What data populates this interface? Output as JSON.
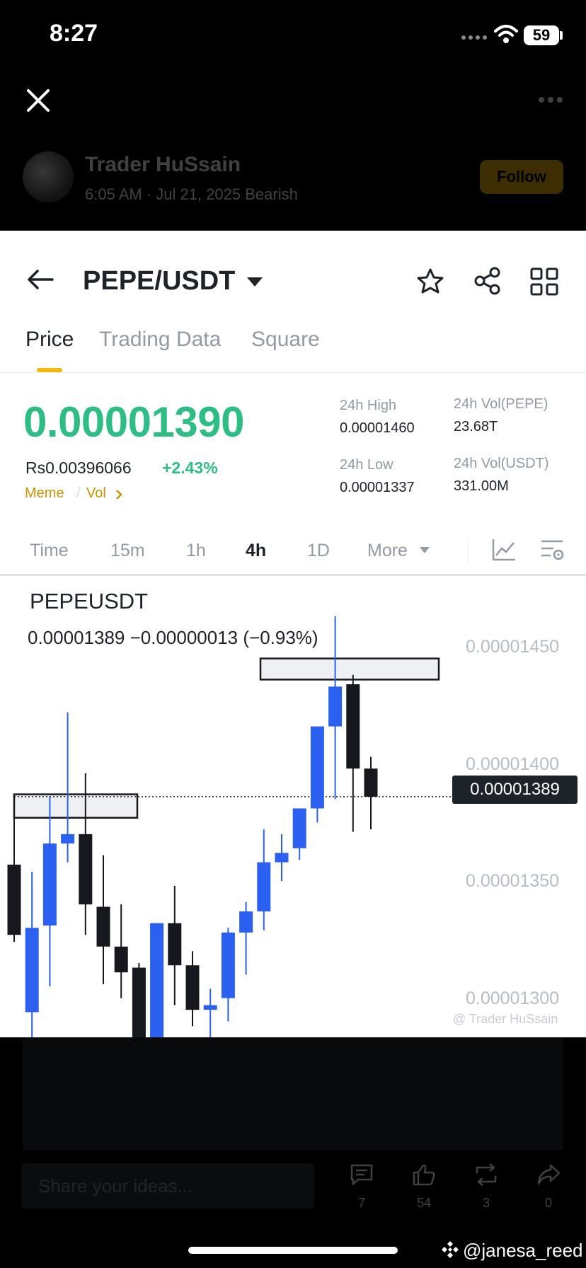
{
  "status_bar": {
    "time": "8:27",
    "battery": "59"
  },
  "post": {
    "author": "Trader HuSsain",
    "meta": "6:05 AM · Jul 21, 2025 Bearish",
    "follow_label": "Follow"
  },
  "header": {
    "pair": "PEPE/USDT"
  },
  "tabs": [
    {
      "label": "Price",
      "active": true
    },
    {
      "label": "Trading Data"
    },
    {
      "label": "Square"
    }
  ],
  "ticker": {
    "last_price": "0.00001390",
    "fiat_price": "Rs0.00396066",
    "change_pct": "+2.43%",
    "tags": [
      "Meme",
      "Vol"
    ],
    "high_label": "24h High",
    "high": "0.00001460",
    "low_label": "24h Low",
    "low": "0.00001337",
    "vol_base_label": "24h Vol(PEPE)",
    "vol_base": "23.68T",
    "vol_quote_label": "24h Vol(USDT)",
    "vol_quote": "331.00M"
  },
  "intervals": [
    {
      "label": "Time"
    },
    {
      "label": "15m"
    },
    {
      "label": "1h"
    },
    {
      "label": "4h",
      "active": true
    },
    {
      "label": "1D"
    },
    {
      "label": "More"
    }
  ],
  "chart": {
    "symbol": "PEPEUSDT",
    "ohlc_line": "0.00001389  −0.00000013 (−0.93%)",
    "axis_labels": [
      "0.00001450",
      "0.00001400",
      "0.00001350",
      "0.00001300"
    ],
    "current_price": "0.00001389",
    "watermark": "@ Trader HuSsain"
  },
  "chart_data": {
    "type": "candlestick",
    "symbol": "PEPEUSDT",
    "interval": "4h",
    "ylim": [
      1.27e-05,
      1.47e-05
    ],
    "current_price": 1.389e-05,
    "candles": [
      {
        "o": 1.33e-05,
        "h": 1.38e-05,
        "l": 1.327e-05,
        "c": 1.36e-05,
        "dir": "down"
      },
      {
        "o": 1.297e-05,
        "h": 1.357e-05,
        "l": 1.28e-05,
        "c": 1.333e-05,
        "dir": "up"
      },
      {
        "o": 1.334e-05,
        "h": 1.389e-05,
        "l": 1.308e-05,
        "c": 1.369e-05,
        "dir": "up"
      },
      {
        "o": 1.369e-05,
        "h": 1.425e-05,
        "l": 1.361e-05,
        "c": 1.373e-05,
        "dir": "up"
      },
      {
        "o": 1.373e-05,
        "h": 1.399e-05,
        "l": 1.33e-05,
        "c": 1.343e-05,
        "dir": "down"
      },
      {
        "o": 1.342e-05,
        "h": 1.364e-05,
        "l": 1.309e-05,
        "c": 1.325e-05,
        "dir": "down"
      },
      {
        "o": 1.325e-05,
        "h": 1.343e-05,
        "l": 1.303e-05,
        "c": 1.314e-05,
        "dir": "down"
      },
      {
        "o": 1.316e-05,
        "h": 1.318e-05,
        "l": 1.273e-05,
        "c": 1.286e-05,
        "dir": "down"
      },
      {
        "o": 1.286e-05,
        "h": 1.335e-05,
        "l": 1.276e-05,
        "c": 1.335e-05,
        "dir": "up"
      },
      {
        "o": 1.335e-05,
        "h": 1.351e-05,
        "l": 1.3e-05,
        "c": 1.317e-05,
        "dir": "down"
      },
      {
        "o": 1.317e-05,
        "h": 1.323e-05,
        "l": 1.291e-05,
        "c": 1.298e-05,
        "dir": "down"
      },
      {
        "o": 1.298e-05,
        "h": 1.307e-05,
        "l": 1.277e-05,
        "c": 1.3e-05,
        "dir": "up"
      },
      {
        "o": 1.303e-05,
        "h": 1.333e-05,
        "l": 1.293e-05,
        "c": 1.331e-05,
        "dir": "up"
      },
      {
        "o": 1.331e-05,
        "h": 1.344e-05,
        "l": 1.313e-05,
        "c": 1.34e-05,
        "dir": "up"
      },
      {
        "o": 1.34e-05,
        "h": 1.375e-05,
        "l": 1.332e-05,
        "c": 1.361e-05,
        "dir": "up"
      },
      {
        "o": 1.361e-05,
        "h": 1.373e-05,
        "l": 1.353e-05,
        "c": 1.365e-05,
        "dir": "up"
      },
      {
        "o": 1.367e-05,
        "h": 1.381e-05,
        "l": 1.362e-05,
        "c": 1.384e-05,
        "dir": "up"
      },
      {
        "o": 1.384e-05,
        "h": 1.405e-05,
        "l": 1.378e-05,
        "c": 1.419e-05,
        "dir": "up"
      },
      {
        "o": 1.419e-05,
        "h": 1.466e-05,
        "l": 1.388e-05,
        "c": 1.436e-05,
        "dir": "up"
      },
      {
        "o": 1.437e-05,
        "h": 1.441e-05,
        "l": 1.374e-05,
        "c": 1.401e-05,
        "dir": "down"
      },
      {
        "o": 1.401e-05,
        "h": 1.406e-05,
        "l": 1.375e-05,
        "c": 1.389e-05,
        "dir": "down"
      }
    ],
    "zones": [
      {
        "ylo": 1.439e-05,
        "yhi": 1.448e-05,
        "label": "resistance box"
      },
      {
        "ylo": 1.38e-05,
        "yhi": 1.39e-05,
        "label": "support box"
      }
    ]
  },
  "engagement": {
    "comment_placeholder": "Share your ideas...",
    "comments": "7",
    "likes": "54",
    "reposts": "3",
    "shares": "0"
  },
  "credit": "@janesa_reed",
  "colors": {
    "up": "#2b60f0",
    "down": "#16181d",
    "price_green": "#2ebd85",
    "brand_yellow": "#f0b90b"
  }
}
